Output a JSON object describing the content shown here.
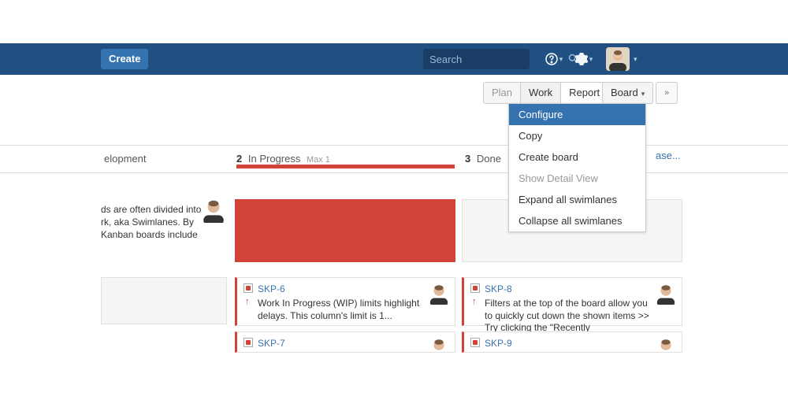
{
  "topbar": {
    "create": "Create",
    "search_placeholder": "Search"
  },
  "board_header": {
    "tabs": {
      "plan": "Plan",
      "work": "Work",
      "report": "Report"
    },
    "board_btn": "Board",
    "dropdown": {
      "configure": "Configure",
      "copy": "Copy",
      "create_board": "Create board",
      "show_detail": "Show Detail View",
      "expand": "Expand all swimlanes",
      "collapse": "Collapse all swimlanes"
    }
  },
  "release_link": "ase...",
  "columns": {
    "c0": {
      "name": "elopment"
    },
    "c1": {
      "count": "2",
      "name": "In Progress",
      "max": "Max 1"
    },
    "c2": {
      "count": "3",
      "name": "Done"
    }
  },
  "swim1": {
    "left_text": "ds are often divided into\nrk, aka Swimlanes. By\nKanban boards include"
  },
  "cards": {
    "skp6": {
      "key": "SKP-6",
      "summary": "Work In Progress (WIP) limits highlight delays. This column's limit is 1..."
    },
    "skp7": {
      "key": "SKP-7"
    },
    "skp8": {
      "key": "SKP-8",
      "summary": "Filters at the top of the board allow you to quickly cut down the shown items >> Try clicking the \"Recently"
    },
    "skp9": {
      "key": "SKP-9"
    }
  }
}
